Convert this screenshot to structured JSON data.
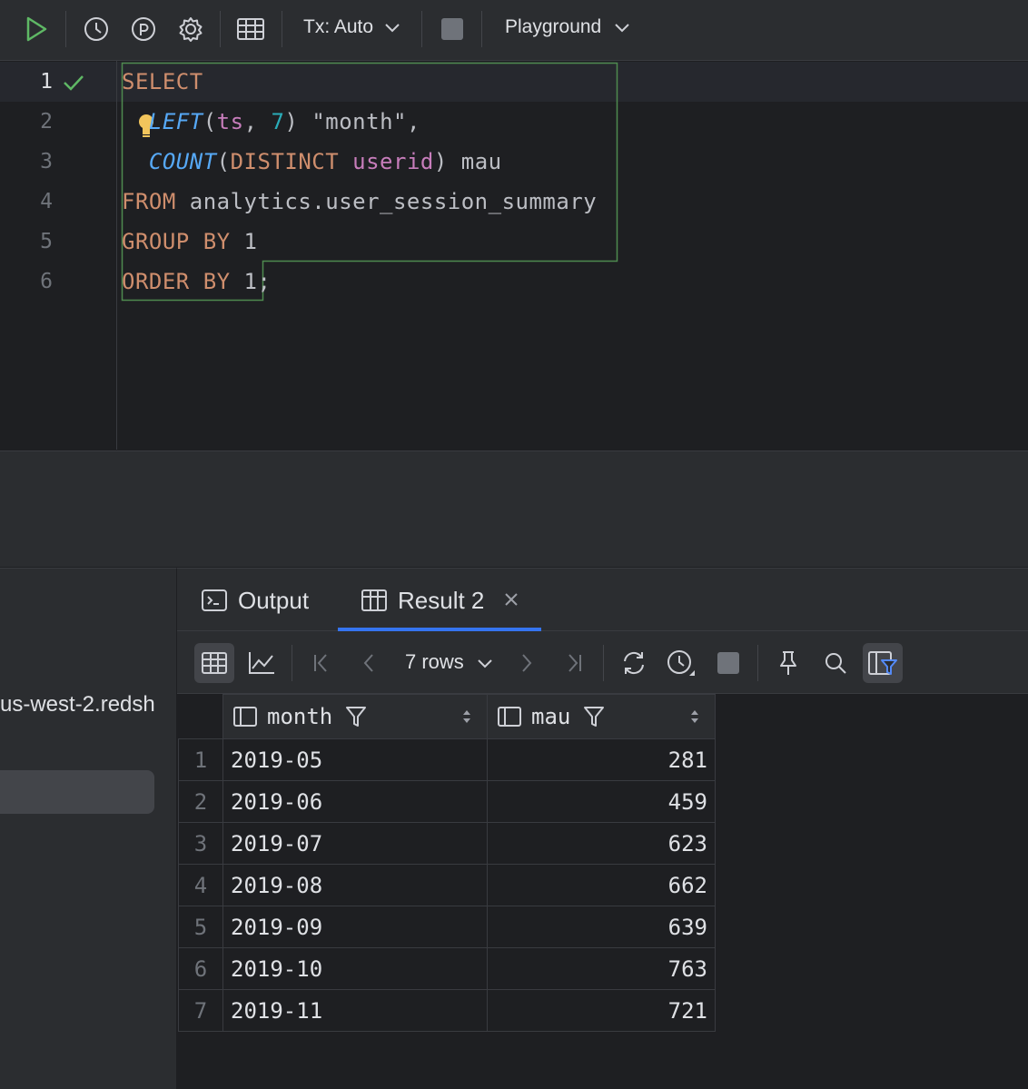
{
  "toolbar": {
    "tx_label": "Tx: Auto",
    "playground_label": "Playground",
    "icons": [
      "run-icon",
      "history-icon",
      "parameter-icon",
      "settings-icon",
      "table-icon",
      "stop-icon"
    ]
  },
  "editor": {
    "line_numbers": [
      "1",
      "2",
      "3",
      "4",
      "5",
      "6"
    ],
    "lines": {
      "l1": {
        "kw": "SELECT"
      },
      "l2": {
        "fn": "LEFT",
        "open": "(",
        "id": "ts",
        "comma": ", ",
        "num": "7",
        "rest": ") \"month\","
      },
      "l3": {
        "fn": "COUNT",
        "open": "(",
        "kw": "DISTINCT",
        "sp": " ",
        "id": "userid",
        "rest": ") mau"
      },
      "l4": {
        "kw": "FROM",
        "rest": " analytics.user_session_summary"
      },
      "l5": {
        "kw": "GROUP BY",
        "rest": " 1"
      },
      "l6": {
        "kw": "ORDER BY",
        "rest": " 1;"
      }
    }
  },
  "left_panel": {
    "connection_text": "us-west-2.redsh"
  },
  "tabs": {
    "output": "Output",
    "result": "Result 2"
  },
  "grid_toolbar": {
    "rows_label": "7 rows"
  },
  "table": {
    "columns": [
      "month",
      "mau"
    ],
    "rows": [
      {
        "n": "1",
        "month": "2019-05",
        "mau": "281"
      },
      {
        "n": "2",
        "month": "2019-06",
        "mau": "459"
      },
      {
        "n": "3",
        "month": "2019-07",
        "mau": "623"
      },
      {
        "n": "4",
        "month": "2019-08",
        "mau": "662"
      },
      {
        "n": "5",
        "month": "2019-09",
        "mau": "639"
      },
      {
        "n": "6",
        "month": "2019-10",
        "mau": "763"
      },
      {
        "n": "7",
        "month": "2019-11",
        "mau": "721"
      }
    ]
  },
  "colors": {
    "run_green": "#5fb865",
    "check_green": "#5fb865",
    "bulb_yellow": "#f2c55c",
    "tab_underline": "#3574f0",
    "selection_border": "#4e8a4f"
  }
}
